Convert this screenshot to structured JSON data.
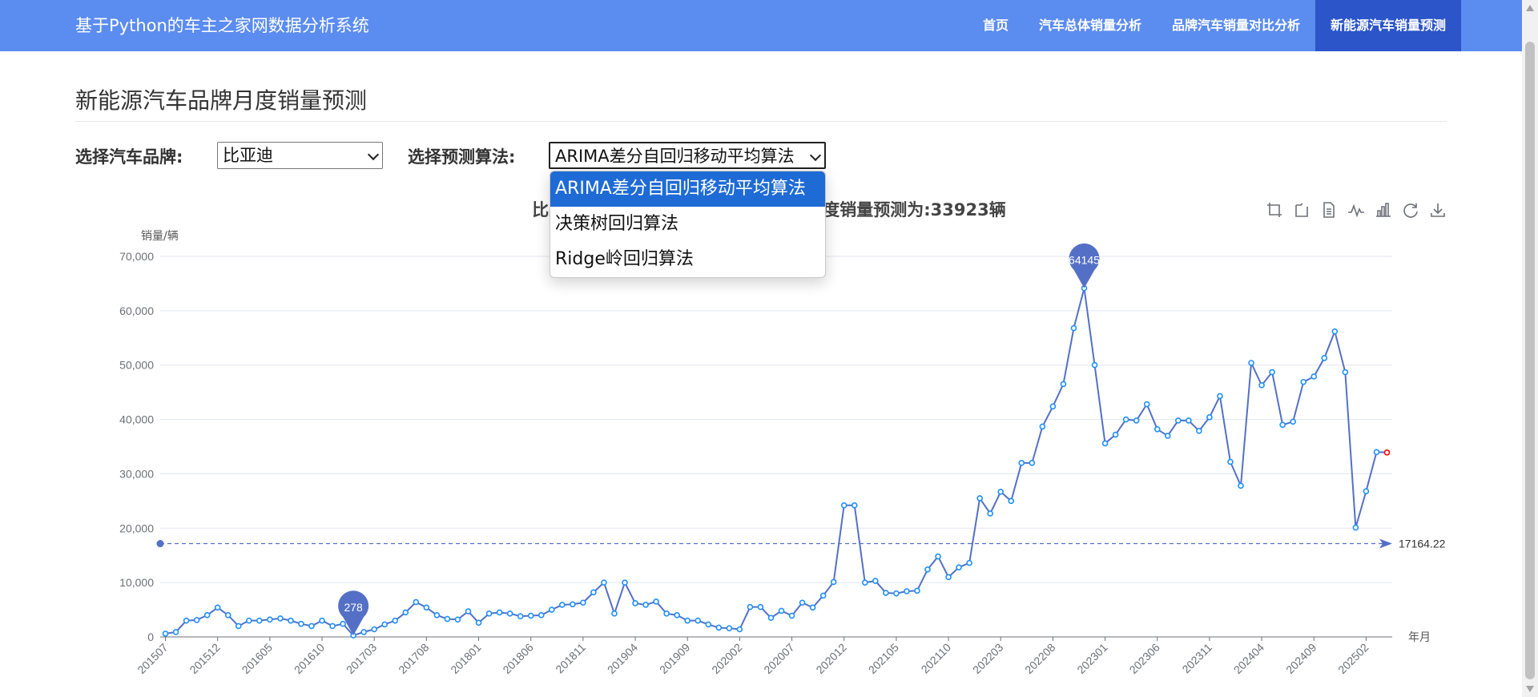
{
  "app": {
    "title": "基于Python的车主之家网数据分析系统",
    "nav": [
      {
        "label": "首页",
        "active": false
      },
      {
        "label": "汽车总体销量分析",
        "active": false
      },
      {
        "label": "品牌汽车销量对比分析",
        "active": false
      },
      {
        "label": "新能源汽车销量预测",
        "active": true
      }
    ]
  },
  "page": {
    "title": "新能源汽车品牌月度销量预测",
    "brand_label": "选择汽车品牌:",
    "brand_value": "比亚迪",
    "algo_label": "选择预测算法:",
    "algo_value": "ARIMA差分自回归移动平均算法",
    "algo_options": [
      "ARIMA差分自回归移动平均算法",
      "决策树回归算法",
      "Ridge岭回归算法"
    ]
  },
  "chart": {
    "title_left": "比亚迪",
    "title_right": "度销量预测为:33923辆",
    "y_unit": "销量/辆",
    "x_unit": "年月",
    "toolbox_icons": [
      "zoom-icon",
      "zoom-reset-icon",
      "data-view-icon",
      "line-type-icon",
      "bar-type-icon",
      "restore-icon",
      "save-image-icon"
    ]
  },
  "chart_data": {
    "type": "line",
    "ylim": [
      0,
      70000
    ],
    "yticks": [
      "0",
      "10,000",
      "20,000",
      "30,000",
      "40,000",
      "50,000",
      "60,000",
      "70,000"
    ],
    "xtick_labels": [
      "201507",
      "201512",
      "201605",
      "201610",
      "201703",
      "201708",
      "201801",
      "201806",
      "201811",
      "201904",
      "201909",
      "202002",
      "202007",
      "202012",
      "202105",
      "202110",
      "202203",
      "202208",
      "202301",
      "202306",
      "202311",
      "202404",
      "202409",
      "202502"
    ],
    "values": [
      600,
      900,
      3000,
      3100,
      4000,
      5400,
      4000,
      2000,
      3000,
      3000,
      3200,
      3400,
      3000,
      2400,
      2000,
      3000,
      2000,
      2400,
      278,
      900,
      1400,
      2300,
      3000,
      4500,
      6400,
      5400,
      4000,
      3300,
      3200,
      4700,
      2600,
      4300,
      4500,
      4300,
      3800,
      3900,
      4000,
      5000,
      5900,
      6000,
      6300,
      8200,
      10000,
      4300,
      10000,
      6200,
      5900,
      6500,
      4300,
      4000,
      3000,
      3000,
      2300,
      1700,
      1600,
      1400,
      5500,
      5500,
      3500,
      4800,
      3900,
      6300,
      5400,
      7600,
      10100,
      24200,
      24200,
      10000,
      10300,
      8100,
      8000,
      8400,
      8500,
      12400,
      14800,
      11000,
      12800,
      13600,
      25500,
      22700,
      26700,
      25000,
      32000,
      32000,
      38700,
      42400,
      46500,
      56800,
      64145,
      50000,
      35600,
      37200,
      40000,
      39800,
      42800,
      38200,
      37000,
      39800,
      39800,
      37900,
      40400,
      44300,
      32200,
      27800,
      50400,
      46300,
      48700,
      39000,
      39600,
      46900,
      47900,
      51300,
      56200,
      48700,
      20100,
      26800,
      34000,
      33923
    ],
    "max": {
      "label": "64145",
      "value": 64145
    },
    "min": {
      "label": "278",
      "value": 278
    },
    "average": {
      "label": "17164.22",
      "value": 17164.22
    },
    "prediction": {
      "value": 33923,
      "color": "#ff0000"
    },
    "line_color": "#5470c6",
    "point_color": "#1e90ff"
  }
}
